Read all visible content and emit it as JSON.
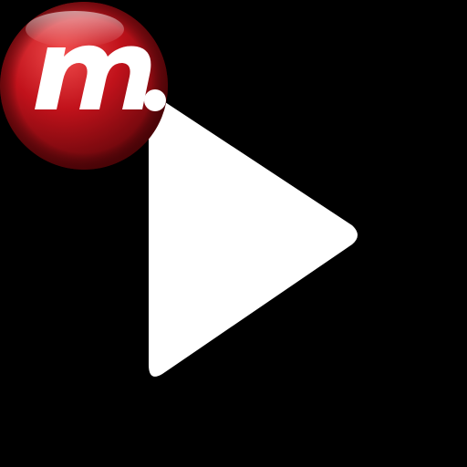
{
  "app_icon": {
    "background_color": "#000000",
    "play_icon": {
      "name": "play-icon",
      "color": "#FFFFFF"
    },
    "logo": {
      "name": "m-logo-icon",
      "text": "m.",
      "ball_color": "#C1121B",
      "ball_highlight_color": "#F04C4C",
      "ball_shadow_color": "#5A0509",
      "letter_color": "#FFFFFF"
    }
  }
}
